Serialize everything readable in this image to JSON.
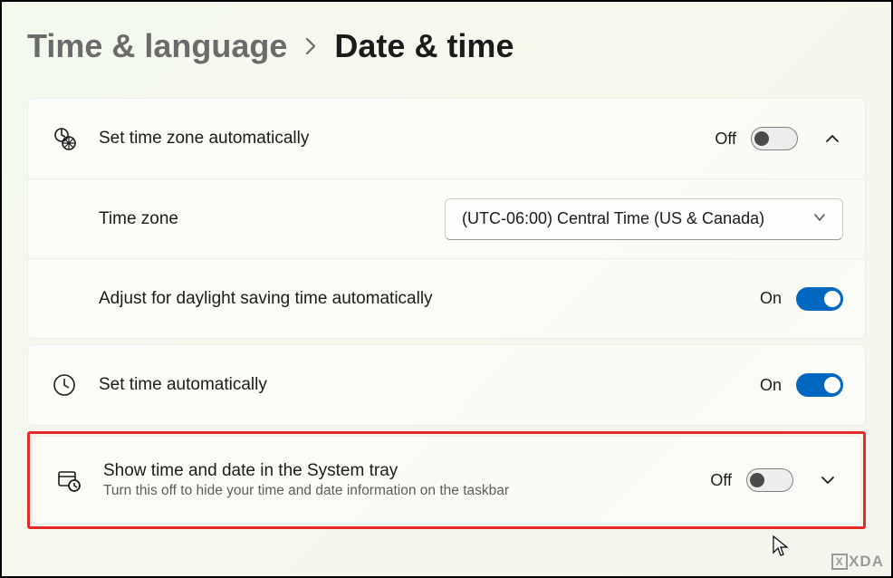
{
  "breadcrumb": {
    "parent": "Time & language",
    "current": "Date & time"
  },
  "rows": {
    "set_tz_auto": {
      "label": "Set time zone automatically",
      "state": "Off",
      "toggled": false
    },
    "time_zone": {
      "label": "Time zone",
      "value": "(UTC-06:00) Central Time (US & Canada)"
    },
    "dst": {
      "label": "Adjust for daylight saving time automatically",
      "state": "On",
      "toggled": true
    },
    "set_time_auto": {
      "label": "Set time automatically",
      "state": "On",
      "toggled": true
    },
    "systray": {
      "label": "Show time and date in the System tray",
      "sublabel": "Turn this off to hide your time and date information on the taskbar",
      "state": "Off",
      "toggled": false
    }
  },
  "watermark": {
    "part1": "XDA"
  }
}
